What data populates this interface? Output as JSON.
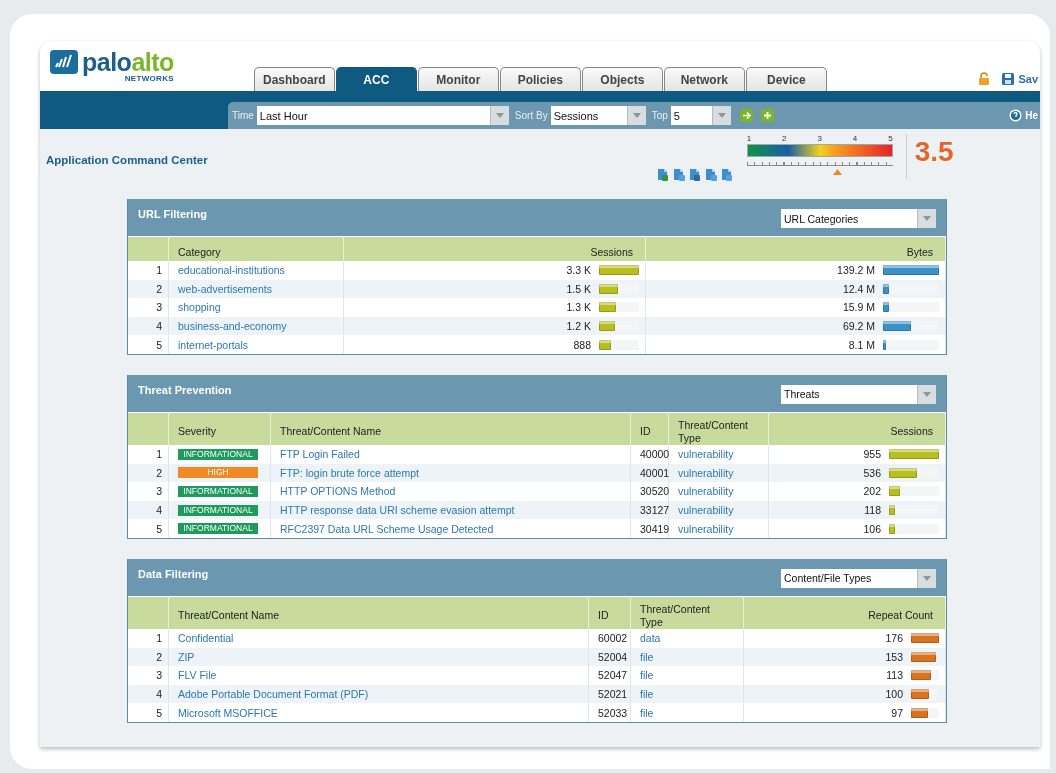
{
  "logo": {
    "name_part_1": "palo",
    "name_part_2": "alto",
    "tagline": "NETWORKS"
  },
  "tabs": [
    {
      "label": "Dashboard",
      "selected": false
    },
    {
      "label": "ACC",
      "selected": true
    },
    {
      "label": "Monitor",
      "selected": false
    },
    {
      "label": "Policies",
      "selected": false
    },
    {
      "label": "Objects",
      "selected": false
    },
    {
      "label": "Network",
      "selected": false
    },
    {
      "label": "Device",
      "selected": false
    }
  ],
  "header_actions": {
    "save": "Sav",
    "help": "He"
  },
  "toolbar": {
    "time_label": "Time",
    "time_value": "Last Hour",
    "sort_label": "Sort By",
    "sort_value": "Sessions",
    "top_label": "Top",
    "top_value": "5"
  },
  "page_title": "Application Command Center",
  "risk_meter": {
    "scale": [
      "1",
      "2",
      "3",
      "4",
      "5"
    ],
    "level": 0.62,
    "value": "3.5"
  },
  "panels": [
    {
      "title": "URL Filtering",
      "dropdown": "URL Categories",
      "columns": [
        {
          "label": "Category",
          "kind": "link"
        },
        {
          "label": "Sessions",
          "kind": "bar",
          "color": "#b8c020"
        },
        {
          "label": "Bytes",
          "kind": "bar",
          "color": "#3a92cc"
        }
      ],
      "rows": [
        {
          "number": "1",
          "cells": [
            "educational-institutions",
            {
              "text": "3.3 K",
              "level": 1
            },
            {
              "text": "139.2 M",
              "level": 1
            }
          ]
        },
        {
          "number": "2",
          "cells": [
            "web-advertisements",
            {
              "text": "1.5 K",
              "level": 0.48
            },
            {
              "text": "12.4 M",
              "level": 0.1
            }
          ]
        },
        {
          "number": "3",
          "cells": [
            "shopping",
            {
              "text": "1.3 K",
              "level": 0.42
            },
            {
              "text": "15.9 M",
              "level": 0.1
            }
          ]
        },
        {
          "number": "4",
          "cells": [
            "business-and-economy",
            {
              "text": "1.2 K",
              "level": 0.4
            },
            {
              "text": "69.2 M",
              "level": 0.5
            }
          ]
        },
        {
          "number": "5",
          "cells": [
            "internet-portals",
            {
              "text": "888",
              "level": 0.3
            },
            {
              "text": "8.1 M",
              "level": 0.06
            }
          ]
        }
      ]
    },
    {
      "title": "Threat Prevention",
      "dropdown": "Threats",
      "columns": [
        {
          "label": "Severity",
          "kind": "severity"
        },
        {
          "label": "Threat/Content Name",
          "kind": "link"
        },
        {
          "label": "ID",
          "kind": "plain"
        },
        {
          "label": "Threat/Content Type",
          "kind": "link"
        },
        {
          "label": "Sessions",
          "kind": "bar",
          "color": "#b8c020"
        }
      ],
      "rows": [
        {
          "number": "1",
          "cells": [
            {
              "text": "INFORMATIONAL",
              "color": "#1e9a5c"
            },
            "FTP Login Failed",
            "40000",
            "vulnerability",
            {
              "text": "955",
              "level": 1
            }
          ]
        },
        {
          "number": "2",
          "cells": [
            {
              "text": "HIGH",
              "color": "#f08a24"
            },
            "FTP: login brute force attempt",
            "40001",
            "vulnerability",
            {
              "text": "536",
              "level": 0.56
            }
          ]
        },
        {
          "number": "3",
          "cells": [
            {
              "text": "INFORMATIONAL",
              "color": "#1e9a5c"
            },
            "HTTP OPTIONS Method",
            "30520",
            "vulnerability",
            {
              "text": "202",
              "level": 0.21
            }
          ]
        },
        {
          "number": "4",
          "cells": [
            {
              "text": "INFORMATIONAL",
              "color": "#1e9a5c"
            },
            "HTTP response data URI scheme evasion attempt",
            "33127",
            "vulnerability",
            {
              "text": "118",
              "level": 0.12
            }
          ]
        },
        {
          "number": "5",
          "cells": [
            {
              "text": "INFORMATIONAL",
              "color": "#1e9a5c"
            },
            "RFC2397 Data URL Scheme Usage Detected",
            "30419",
            "vulnerability",
            {
              "text": "106",
              "level": 0.11
            }
          ]
        }
      ]
    },
    {
      "title": "Data Filtering",
      "dropdown": "Content/File Types",
      "columns": [
        {
          "label": "Threat/Content Name",
          "kind": "link"
        },
        {
          "label": "ID",
          "kind": "plain"
        },
        {
          "label": "Threat/Content Type",
          "kind": "link"
        },
        {
          "label": "Repeat Count",
          "kind": "bar",
          "color": "#d9731f"
        }
      ],
      "rows": [
        {
          "number": "1",
          "cells": [
            "Confidential",
            "60002",
            "data",
            {
              "text": "176",
              "level": 1
            }
          ]
        },
        {
          "number": "2",
          "cells": [
            "ZIP",
            "52004",
            "file",
            {
              "text": "153",
              "level": 0.9
            }
          ]
        },
        {
          "number": "3",
          "cells": [
            "FLV File",
            "52047",
            "file",
            {
              "text": "113",
              "level": 0.7
            }
          ]
        },
        {
          "number": "4",
          "cells": [
            "Adobe Portable Document Format (PDF)",
            "52021",
            "file",
            {
              "text": "100",
              "level": 0.65
            }
          ]
        },
        {
          "number": "5",
          "cells": [
            "Microsoft MSOFFICE",
            "52033",
            "file",
            {
              "text": "97",
              "level": 0.6
            }
          ]
        }
      ]
    }
  ]
}
